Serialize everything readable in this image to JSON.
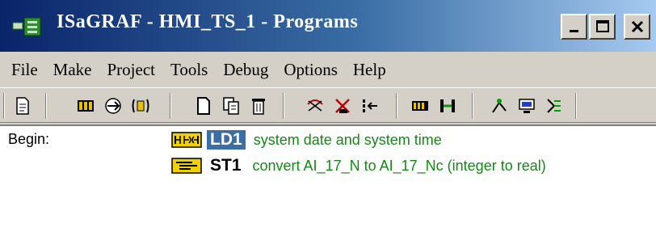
{
  "window": {
    "title": "ISaGRAF - HMI_TS_1 - Programs",
    "controls": {
      "minimize": "_",
      "maximize": "□",
      "close": "×"
    }
  },
  "menu": {
    "items": [
      {
        "label": "File"
      },
      {
        "label": "Make"
      },
      {
        "label": "Project"
      },
      {
        "label": "Tools"
      },
      {
        "label": "Debug"
      },
      {
        "label": "Options"
      },
      {
        "label": "Help"
      }
    ]
  },
  "toolbar": {
    "buttons": [
      {
        "icon": "document-properties-icon"
      },
      {
        "icon": "dictionary-icon"
      },
      {
        "icon": "link-icon"
      },
      {
        "icon": "io-connection-icon"
      },
      {
        "icon": "new-program-icon"
      },
      {
        "icon": "copy-icon"
      },
      {
        "icon": "delete-icon"
      },
      {
        "icon": "verify-icon"
      },
      {
        "icon": "code-icon"
      },
      {
        "icon": "move-icon"
      },
      {
        "icon": "library-icon"
      },
      {
        "icon": "connect-icon"
      },
      {
        "icon": "run-icon"
      },
      {
        "icon": "monitor-icon"
      },
      {
        "icon": "variables-icon"
      }
    ]
  },
  "programs": {
    "section_label": "Begin:",
    "items": [
      {
        "name": "LD1",
        "type": "LD",
        "description": "system date and system time",
        "selected": true
      },
      {
        "name": "ST1",
        "type": "ST",
        "description": "convert AI_17_N to AI_17_Nc (integer to real)",
        "selected": false
      }
    ]
  },
  "colors": {
    "title_gradient_start": "#0a246a",
    "selection": "#3a6ea5",
    "description_text": "#138a13",
    "chrome": "#d4d0c8"
  }
}
